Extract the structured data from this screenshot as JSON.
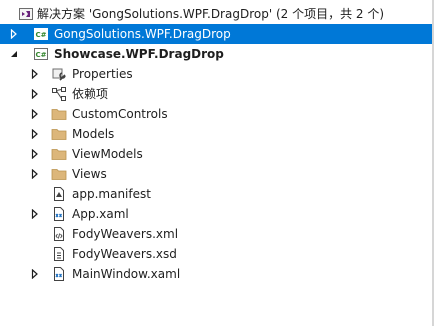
{
  "solution": {
    "label": "解决方案 'GongSolutions.WPF.DragDrop' (2 个项目，共 2 个)",
    "icon": "solution-icon"
  },
  "projects": [
    {
      "label": "GongSolutions.WPF.DragDrop",
      "icon": "csharp-project-icon",
      "expanded": false,
      "selected": true
    },
    {
      "label": "Showcase.WPF.DragDrop",
      "icon": "csharp-project-icon",
      "expanded": true,
      "selected": false
    }
  ],
  "items": [
    {
      "label": "Properties",
      "icon": "properties-wrench-icon",
      "expandable": true
    },
    {
      "label": "依赖项",
      "icon": "dependencies-icon",
      "expandable": true
    },
    {
      "label": "CustomControls",
      "icon": "folder-icon",
      "expandable": true
    },
    {
      "label": "Models",
      "icon": "folder-icon",
      "expandable": true
    },
    {
      "label": "ViewModels",
      "icon": "folder-icon",
      "expandable": true
    },
    {
      "label": "Views",
      "icon": "folder-icon",
      "expandable": true
    },
    {
      "label": "app.manifest",
      "icon": "manifest-file-icon",
      "expandable": false
    },
    {
      "label": "App.xaml",
      "icon": "xaml-file-icon",
      "expandable": true
    },
    {
      "label": "FodyWeavers.xml",
      "icon": "xml-file-icon",
      "expandable": false
    },
    {
      "label": "FodyWeavers.xsd",
      "icon": "xsd-file-icon",
      "expandable": false
    },
    {
      "label": "MainWindow.xaml",
      "icon": "xaml-file-icon",
      "expandable": true
    }
  ],
  "colors": {
    "selection": "#0078d7",
    "folder": "#dcb67a",
    "csharp": "#368832",
    "arrow": "#1e1e1e"
  }
}
